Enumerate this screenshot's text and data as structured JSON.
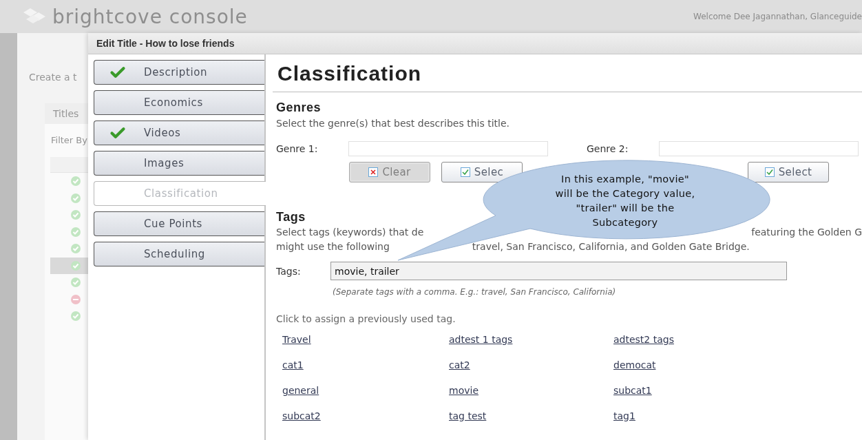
{
  "background": {
    "logo": "brightcove console",
    "welcome": "Welcome Dee Jagannathan, Glanceguide",
    "create_text": "Create a t",
    "tab": "Titles",
    "filter_label": "Filter By",
    "rows": [
      {
        "kind": "ok",
        "selected": false
      },
      {
        "kind": "ok",
        "selected": false
      },
      {
        "kind": "ok",
        "selected": false
      },
      {
        "kind": "ok",
        "selected": false
      },
      {
        "kind": "ok",
        "selected": false
      },
      {
        "kind": "ok",
        "selected": true
      },
      {
        "kind": "ok",
        "selected": false
      },
      {
        "kind": "error",
        "selected": false
      },
      {
        "kind": "ok",
        "selected": false
      }
    ]
  },
  "dialog": {
    "title": "Edit Title - How to lose friends",
    "nav": [
      {
        "label": "Description",
        "done": true,
        "selected": false
      },
      {
        "label": "Economics",
        "done": false,
        "selected": false
      },
      {
        "label": "Videos",
        "done": true,
        "selected": false
      },
      {
        "label": "Images",
        "done": false,
        "selected": false
      },
      {
        "label": "Classification",
        "done": false,
        "selected": true
      },
      {
        "label": "Cue Points",
        "done": false,
        "selected": false
      },
      {
        "label": "Scheduling",
        "done": false,
        "selected": false
      }
    ],
    "heading": "Classification",
    "genres": {
      "heading": "Genres",
      "description": "Select the genre(s) that best describes this title.",
      "fields": [
        {
          "label": "Genre 1:",
          "buttons": [
            {
              "label": "Clear",
              "kind": "clear",
              "disabled": true
            },
            {
              "label": "Selec",
              "kind": "select",
              "disabled": false
            }
          ]
        },
        {
          "label": "Genre 2:",
          "buttons": [
            {
              "label": "Select",
              "kind": "select",
              "disabled": false
            }
          ]
        }
      ]
    },
    "tags": {
      "heading": "Tags",
      "description_parts": [
        "Select tags (keywords) that de",
        "featuring the Golden G",
        "might use the following",
        "travel, San Francisco, California, and Golden Gate Bridge."
      ],
      "label": "Tags:",
      "value": "movie, trailer",
      "hint": "(Separate tags with a comma. E.g.: travel, San Francisco, California)",
      "assign_text": "Click to assign a previously used tag.",
      "previous": [
        "Travel",
        "adtest 1 tags",
        "adtest2 tags",
        "cat1",
        "cat2",
        "democat",
        "general",
        "movie",
        "subcat1",
        "subcat2",
        "tag test",
        "tag1"
      ]
    }
  },
  "callout": {
    "text": "In this example, \"movie\"\nwill be the Category value,\n\"trailer\" will be the\nSubcategory"
  }
}
